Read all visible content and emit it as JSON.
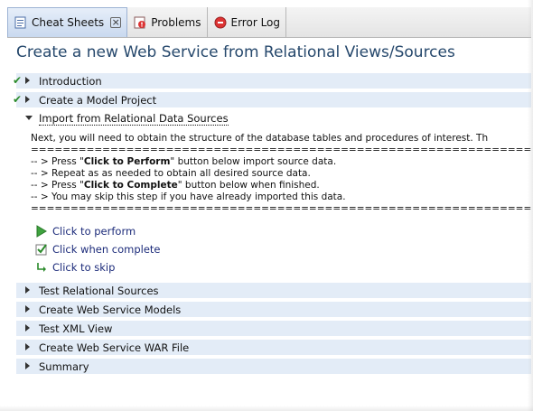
{
  "tabs": [
    {
      "label": "Cheat Sheets",
      "active": true
    },
    {
      "label": "Problems",
      "active": false
    },
    {
      "label": "Error Log",
      "active": false
    }
  ],
  "cheatsheet": {
    "title": "Create a new Web Service from Relational Views/Sources",
    "steps": [
      {
        "label": "Introduction",
        "completed": true
      },
      {
        "label": "Create a Model Project",
        "completed": true
      },
      {
        "label": "Import from Relational Data Sources",
        "expanded": true
      },
      {
        "label": "Test Relational Sources"
      },
      {
        "label": "Create Web Service Models"
      },
      {
        "label": "Test XML View"
      },
      {
        "label": "Create Web Service WAR File"
      },
      {
        "label": "Summary"
      }
    ],
    "description": {
      "intro": "Next, you will need to obtain the structure of the database tables and procedures of interest. Th",
      "separator": "=================================================================================================================",
      "line1_pre": "-- > Press \"",
      "line1_bold": "Click to Perform",
      "line1_post": "\" button below import source data.",
      "line2": "-- > Repeat as as needed to obtain all desired source data.",
      "line3_pre": "-- > Press \"",
      "line3_bold": "Click to Complete",
      "line3_post": "\" button below when finished.",
      "line4": "-- > You may skip this step if you have already imported this data."
    },
    "actions": {
      "perform": "Click to perform",
      "complete": "Click when complete",
      "skip": "Click to skip"
    }
  },
  "colors": {
    "title": "#26486c",
    "step_background": "#e3ecf7",
    "link": "#1c2b7a",
    "check": "#2a8a2a"
  }
}
